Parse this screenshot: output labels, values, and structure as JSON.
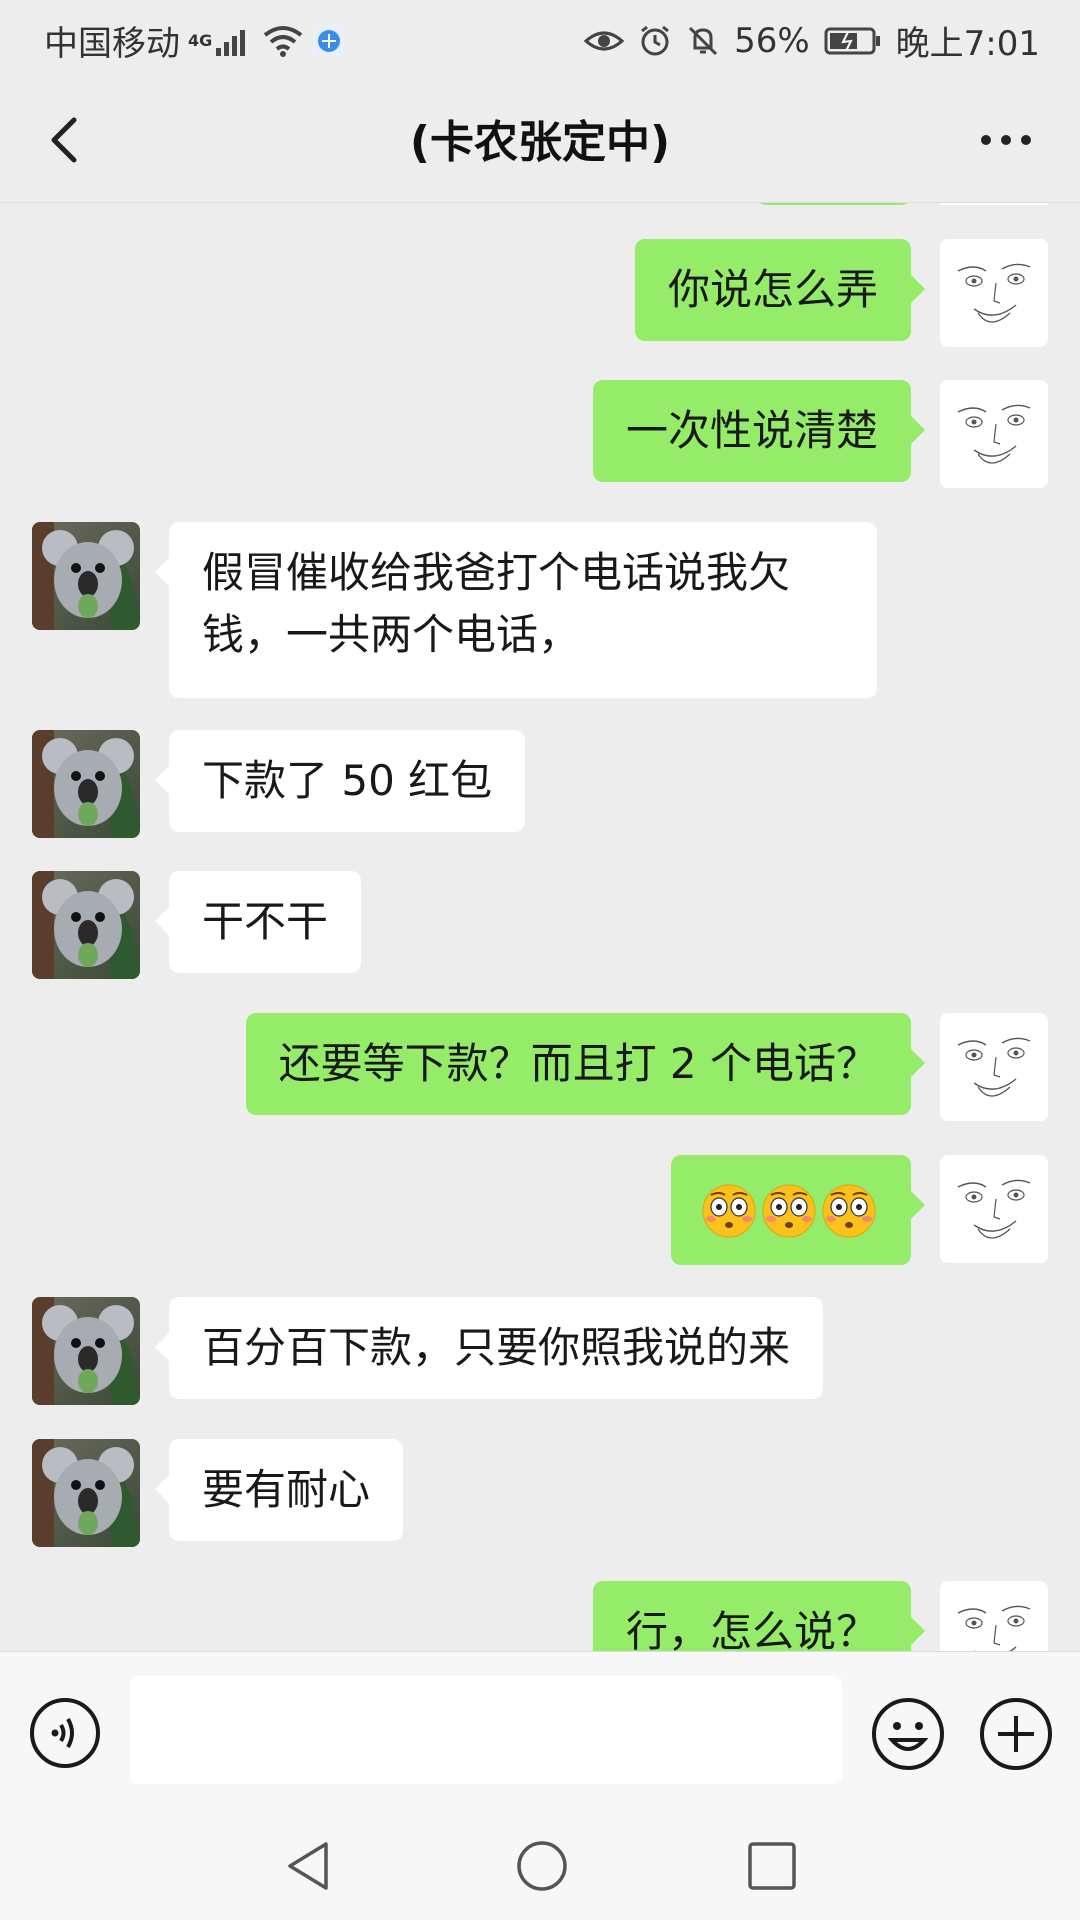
{
  "status_bar": {
    "carrier": "中国移动",
    "network": "4G",
    "battery": "56%",
    "time": "晚上7:01"
  },
  "header": {
    "title": "(卡农张定中)"
  },
  "messages": [
    {
      "side": "out",
      "text": "你说怎么弄"
    },
    {
      "side": "out",
      "text": "一次性说清楚"
    },
    {
      "side": "in",
      "text": "假冒催收给我爸打个电话说我欠钱，一共两个电话，"
    },
    {
      "side": "in",
      "text": "下款了 50 红包"
    },
    {
      "side": "in",
      "text": "干不干"
    },
    {
      "side": "out",
      "text": "还要等下款？而且打 2 个电话？"
    },
    {
      "side": "out",
      "emoji": "flushed-face-emoji",
      "count": 3
    },
    {
      "side": "in",
      "text": "百分百下款，只要你照我说的来"
    },
    {
      "side": "in",
      "text": "要有耐心"
    },
    {
      "side": "out",
      "text": "行，怎么说？"
    }
  ],
  "input": {
    "placeholder": ""
  },
  "colors": {
    "background": "#ededed",
    "outgoing_bubble": "#95ec69",
    "incoming_bubble": "#ffffff"
  }
}
